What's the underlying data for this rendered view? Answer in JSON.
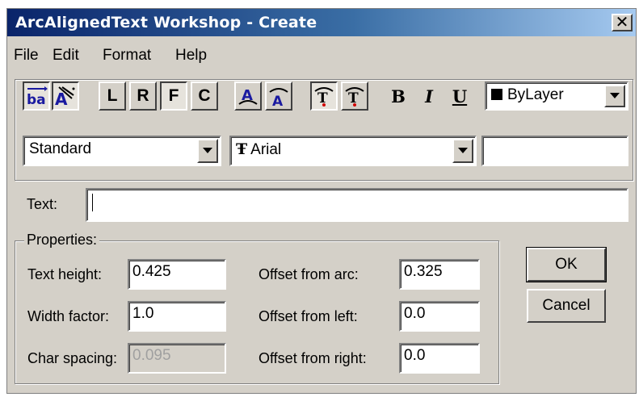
{
  "window": {
    "title": "ArcAlignedText Workshop - Create",
    "close_label": "✕"
  },
  "menu": [
    "File",
    "Edit",
    "Format",
    "Help"
  ],
  "toolbar": {
    "align_left_label": "L",
    "align_right_label": "R",
    "align_fit_label": "F",
    "align_center_label": "C",
    "bold_label": "B",
    "italic_label": "I",
    "underline_label": "U",
    "color_value": "ByLayer",
    "text_style_value": "Standard",
    "font_value": "Arial",
    "font_icon_glyph": "Ŧ"
  },
  "text": {
    "label": "Text:",
    "value": ""
  },
  "properties": {
    "legend": "Properties:",
    "text_height_label": "Text height:",
    "text_height_value": "0.425",
    "width_factor_label": "Width factor:",
    "width_factor_value": "1.0",
    "char_spacing_label": "Char spacing:",
    "char_spacing_value": "0.095",
    "offset_arc_label": "Offset from arc:",
    "offset_arc_value": "0.325",
    "offset_left_label": "Offset from left:",
    "offset_left_value": "0.0",
    "offset_right_label": "Offset from right:",
    "offset_right_value": "0.0"
  },
  "buttons": {
    "ok": "OK",
    "cancel": "Cancel"
  },
  "colors": {
    "title_gradient_start": "#0a246a",
    "face": "#d4d0c8",
    "icon_blue": "#1a1aa0",
    "icon_red": "#d00000"
  }
}
